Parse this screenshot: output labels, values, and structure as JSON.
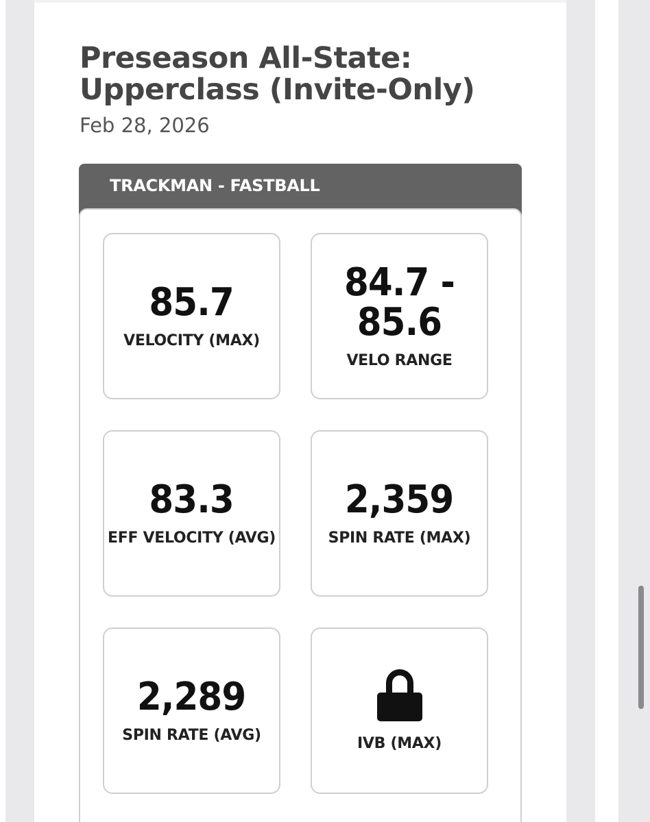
{
  "event": {
    "title_line1": "Preseason All-State:",
    "title_line2": "Upperclass (Invite-Only)",
    "date": "Feb 28, 2026"
  },
  "panel": {
    "header": "TRACKMAN - FASTBALL",
    "stats": [
      {
        "value": "85.7",
        "label": "VELOCITY (MAX)"
      },
      {
        "value_line1": "84.7 -",
        "value_line2": "85.6",
        "label": "VELO RANGE"
      },
      {
        "value": "83.3",
        "label": "EFF VELOCITY (AVG)"
      },
      {
        "value": "2,359",
        "label": "SPIN RATE (MAX)"
      },
      {
        "value": "2,289",
        "label": "SPIN RATE (AVG)"
      },
      {
        "icon": "lock-icon",
        "label": "IVB (MAX)",
        "locked": true
      }
    ]
  }
}
